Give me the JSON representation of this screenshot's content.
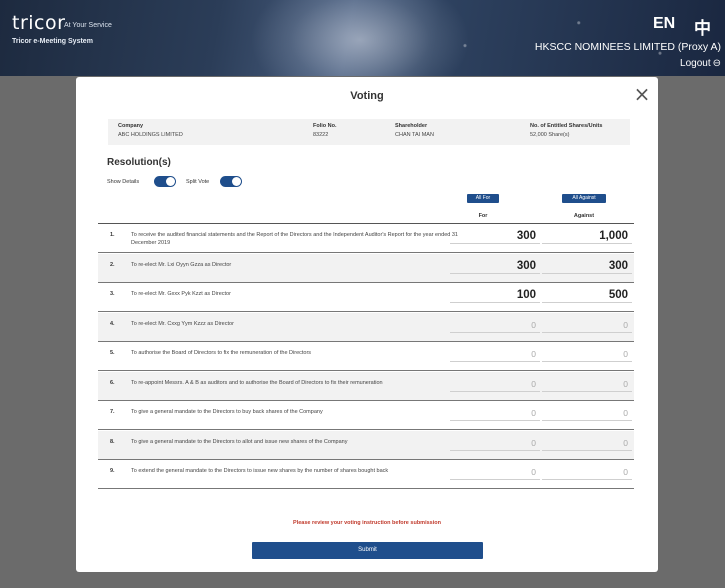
{
  "header": {
    "logo": "tricor",
    "tagline": "At Your Service",
    "system_name": "Tricor e-Meeting System",
    "lang_en": "EN",
    "lang_zh": "中",
    "user": "HKSCC NOMINEES LIMITED (Proxy A)",
    "logout": "Logout"
  },
  "modal": {
    "title": "Voting",
    "info": {
      "company_label": "Company",
      "company_value": "ABC HOLDINGS LIMITED",
      "folio_label": "Folio No.",
      "folio_value": "83222",
      "shareholder_label": "Shareholder",
      "shareholder_value": "CHAN TAI MAN",
      "shares_label": "No. of Entitled Shares/Units",
      "shares_value": "52,000 Share(s)"
    },
    "resolutions_title": "Resolution(s)",
    "show_details_label": "Show Details",
    "split_vote_label": "Split Vote",
    "all_for_label": "All For",
    "all_against_label": "All Against",
    "for_label": "For",
    "against_label": "Against",
    "resolutions": [
      {
        "num": "1.",
        "text": "To receive the audited financial statements and the Report of the Directors and the Independent Auditor's Report for the year ended 31 December 2019",
        "for": "300",
        "against": "1,000"
      },
      {
        "num": "2.",
        "text": "To re-elect Mr. Lxi Oyyn Gzza as Director",
        "for": "300",
        "against": "300"
      },
      {
        "num": "3.",
        "text": "To re-elect Mr. Gxxx Pyk Kzzt as Director",
        "for": "100",
        "against": "500"
      },
      {
        "num": "4.",
        "text": "To re-elect Mr. Cxxg Yym Kzzz as Director",
        "for": "0",
        "against": "0"
      },
      {
        "num": "5.",
        "text": "To authorise the Board of Directors to fix the remuneration of the Directors",
        "for": "0",
        "against": "0"
      },
      {
        "num": "6.",
        "text": "To re-appoint Messrs. A & B as auditors and to authorise the Board of Directors to fix their remuneration",
        "for": "0",
        "against": "0"
      },
      {
        "num": "7.",
        "text": "To give a general mandate to the Directors to buy back shares of the Company",
        "for": "0",
        "against": "0"
      },
      {
        "num": "8.",
        "text": "To give a general mandate to the Directors to allot and issue new shares of the Company",
        "for": "0",
        "against": "0"
      },
      {
        "num": "9.",
        "text": "To extend the general mandate to the Directors to issue new shares by the number of shares bought back",
        "for": "0",
        "against": "0"
      }
    ],
    "warning": "Please review your voting instruction before submission",
    "submit_label": "Submit"
  }
}
